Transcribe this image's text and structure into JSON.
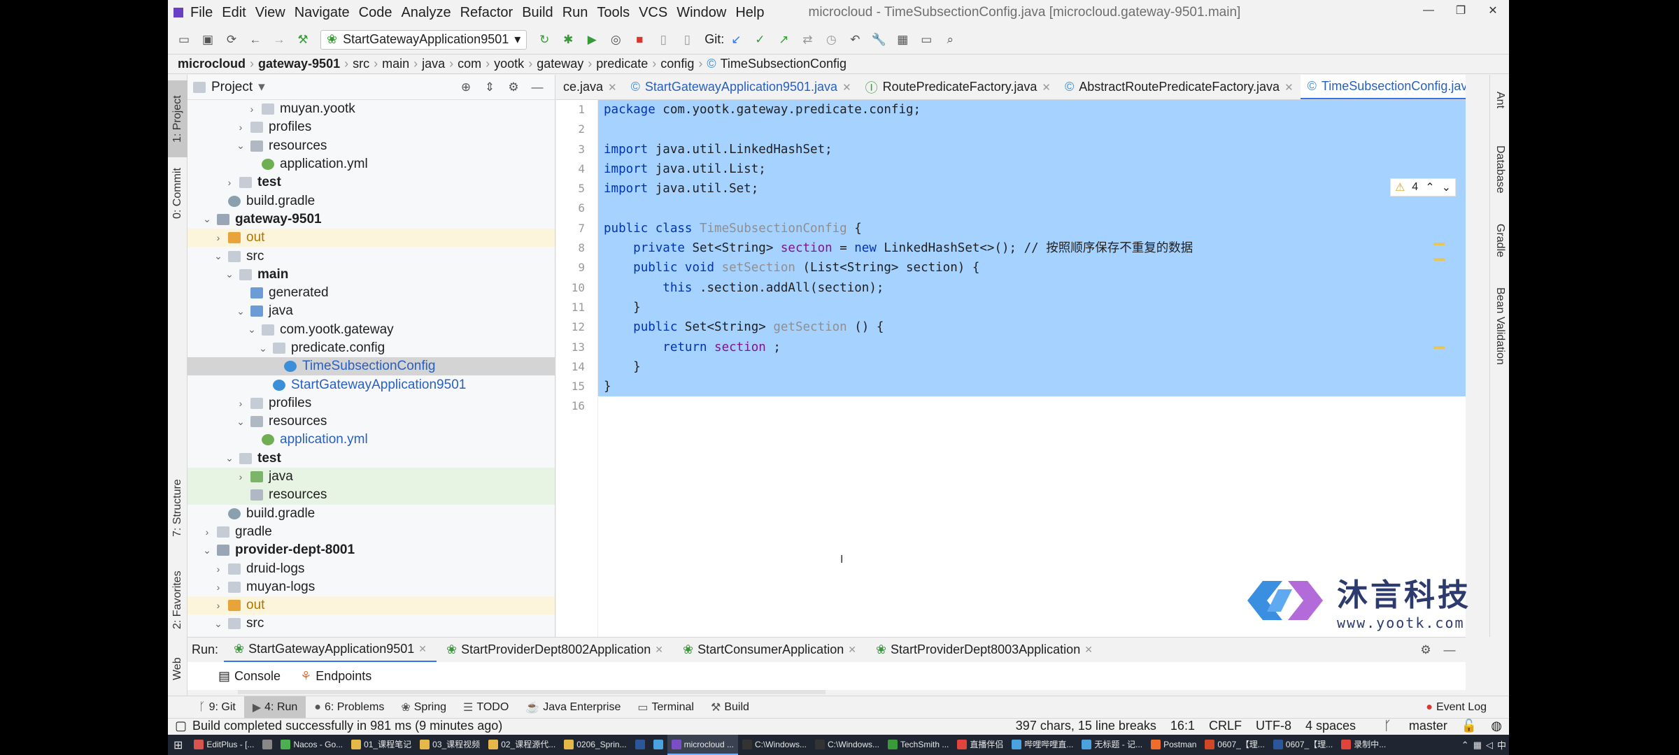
{
  "window": {
    "menu": [
      "File",
      "Edit",
      "View",
      "Navigate",
      "Code",
      "Analyze",
      "Refactor",
      "Build",
      "Run",
      "Tools",
      "VCS",
      "Window",
      "Help"
    ],
    "title": "microcloud - TimeSubsectionConfig.java [microcloud.gateway-9501.main]"
  },
  "toolbar": {
    "run_config": "StartGatewayApplication9501",
    "git_label": "Git:"
  },
  "breadcrumb": [
    "microcloud",
    "gateway-9501",
    "src",
    "main",
    "java",
    "com",
    "yootk",
    "gateway",
    "predicate",
    "config",
    "TimeSubsectionConfig"
  ],
  "left_strip": [
    "1: Project",
    "0: Commit",
    "7: Structure",
    "2: Favorites",
    "Web"
  ],
  "project": {
    "title": "Project",
    "tree": [
      {
        "label": "muyan.yootk",
        "level": 5,
        "chev": "›",
        "icon": "folder",
        "style": ""
      },
      {
        "label": "profiles",
        "level": 4,
        "chev": "›",
        "icon": "folder",
        "style": ""
      },
      {
        "label": "resources",
        "level": 4,
        "chev": "⌄",
        "icon": "folder res",
        "style": ""
      },
      {
        "label": "application.yml",
        "level": 5,
        "chev": "",
        "icon": "yml",
        "style": ""
      },
      {
        "label": "test",
        "level": 3,
        "chev": "›",
        "icon": "folder",
        "style": "bold"
      },
      {
        "label": "build.gradle",
        "level": 2,
        "chev": "",
        "icon": "gradle",
        "style": ""
      },
      {
        "label": "gateway-9501",
        "level": 1,
        "chev": "⌄",
        "icon": "module",
        "style": "bold"
      },
      {
        "label": "out",
        "level": 2,
        "chev": "›",
        "icon": "folder out",
        "style": "excl"
      },
      {
        "label": "src",
        "level": 2,
        "chev": "⌄",
        "icon": "folder",
        "style": ""
      },
      {
        "label": "main",
        "level": 3,
        "chev": "⌄",
        "icon": "folder",
        "style": "bold"
      },
      {
        "label": "generated",
        "level": 4,
        "chev": "",
        "icon": "folder src",
        "style": ""
      },
      {
        "label": "java",
        "level": 4,
        "chev": "⌄",
        "icon": "folder src",
        "style": ""
      },
      {
        "label": "com.yootk.gateway",
        "level": 5,
        "chev": "⌄",
        "icon": "folder",
        "style": ""
      },
      {
        "label": "predicate.config",
        "level": 6,
        "chev": "⌄",
        "icon": "folder",
        "style": ""
      },
      {
        "label": "TimeSubsectionConfig",
        "level": 7,
        "chev": "",
        "icon": "cls",
        "style": "sel blue"
      },
      {
        "label": "StartGatewayApplication9501",
        "level": 6,
        "chev": "",
        "icon": "cls",
        "style": "blue"
      },
      {
        "label": "profiles",
        "level": 4,
        "chev": "›",
        "icon": "folder",
        "style": ""
      },
      {
        "label": "resources",
        "level": 4,
        "chev": "⌄",
        "icon": "folder res",
        "style": ""
      },
      {
        "label": "application.yml",
        "level": 5,
        "chev": "",
        "icon": "yml",
        "style": "blue"
      },
      {
        "label": "test",
        "level": 3,
        "chev": "⌄",
        "icon": "folder",
        "style": "bold"
      },
      {
        "label": "java",
        "level": 4,
        "chev": "›",
        "icon": "folder tst",
        "style": "test"
      },
      {
        "label": "resources",
        "level": 4,
        "chev": "",
        "icon": "folder res",
        "style": "test"
      },
      {
        "label": "build.gradle",
        "level": 2,
        "chev": "",
        "icon": "gradle",
        "style": ""
      },
      {
        "label": "gradle",
        "level": 1,
        "chev": "›",
        "icon": "folder",
        "style": ""
      },
      {
        "label": "provider-dept-8001",
        "level": 1,
        "chev": "⌄",
        "icon": "module",
        "style": "bold"
      },
      {
        "label": "druid-logs",
        "level": 2,
        "chev": "›",
        "icon": "folder",
        "style": ""
      },
      {
        "label": "muyan-logs",
        "level": 2,
        "chev": "›",
        "icon": "folder",
        "style": ""
      },
      {
        "label": "out",
        "level": 2,
        "chev": "›",
        "icon": "folder out",
        "style": "excl"
      },
      {
        "label": "src",
        "level": 2,
        "chev": "⌄",
        "icon": "folder",
        "style": ""
      }
    ]
  },
  "editor_tabs": [
    {
      "label": "ce.java",
      "active": false
    },
    {
      "label": "StartGatewayApplication9501.java",
      "active": false
    },
    {
      "label": "RoutePredicateFactory.java",
      "active": false
    },
    {
      "label": "AbstractRoutePredicateFactory.java",
      "active": false
    },
    {
      "label": "TimeSubsectionConfig.java",
      "active": true
    }
  ],
  "inspection": {
    "warnings": "4"
  },
  "code_lines": [
    [
      [
        "kw",
        "package"
      ],
      [
        "",
        "com.yootk.gateway.predicate.config;"
      ]
    ],
    [],
    [
      [
        "kw",
        "import"
      ],
      [
        "",
        "java.util.LinkedHashSet;"
      ]
    ],
    [
      [
        "kw",
        "import"
      ],
      [
        "",
        "java.util.List;"
      ]
    ],
    [
      [
        "kw",
        "import"
      ],
      [
        "",
        "java.util.Set;"
      ]
    ],
    [],
    [
      [
        "kw",
        "public class"
      ],
      [
        "fn",
        "TimeSubsectionConfig"
      ],
      [
        "",
        "{"
      ]
    ],
    [
      [
        "",
        "    "
      ],
      [
        "kw",
        "private"
      ],
      [
        "",
        "Set<String>"
      ],
      [
        "fld",
        "section"
      ],
      [
        "",
        "="
      ],
      [
        "kw",
        "new"
      ],
      [
        "",
        "LinkedHashSet<>(); // 按照顺序保存不重复的数据"
      ]
    ],
    [
      [
        "",
        "    "
      ],
      [
        "kw",
        "public void"
      ],
      [
        "fn",
        "setSection"
      ],
      [
        "",
        "(List<String> section) {"
      ]
    ],
    [
      [
        "",
        "        "
      ],
      [
        "kw",
        "this"
      ],
      [
        "",
        ".section.addAll(section);"
      ]
    ],
    [
      [
        "",
        "    }"
      ]
    ],
    [
      [
        "",
        "    "
      ],
      [
        "kw",
        "public"
      ],
      [
        "",
        "Set<String>"
      ],
      [
        "fn",
        "getSection"
      ],
      [
        "",
        "() {"
      ]
    ],
    [
      [
        "",
        "        "
      ],
      [
        "kw",
        "return"
      ],
      [
        "fld",
        "section"
      ],
      [
        "",
        ";"
      ]
    ],
    [
      [
        "",
        "    }"
      ]
    ],
    [
      [
        "",
        "}"
      ]
    ],
    []
  ],
  "right_strip": [
    "Ant",
    "Database",
    "Gradle",
    "Bean Validation"
  ],
  "logo": {
    "cn": "沐言科技",
    "url": "www.yootk.com"
  },
  "run": {
    "label": "Run:",
    "tabs": [
      "StartGatewayApplication9501",
      "StartProviderDept8002Application",
      "StartConsumerApplication",
      "StartProviderDept8003Application"
    ],
    "subtabs": [
      "Console",
      "Endpoints"
    ]
  },
  "tool_windows": [
    "9: Git",
    "4: Run",
    "6: Problems",
    "Spring",
    "TODO",
    "Java Enterprise",
    "Terminal",
    "Build"
  ],
  "event_log": "Event Log",
  "status": {
    "message": "Build completed successfully in 981 ms (9 minutes ago)",
    "chars": "397 chars, 15 line breaks",
    "pos": "16:1",
    "eol": "CRLF",
    "enc": "UTF-8",
    "indent": "4 spaces",
    "branch": "master"
  },
  "taskbar": [
    {
      "label": "EditPlus - [...",
      "color": "#d9534f"
    },
    {
      "label": "",
      "color": "#888"
    },
    {
      "label": "Nacos - Go...",
      "color": "#4caf50"
    },
    {
      "label": "01_课程笔记",
      "color": "#e6b84a"
    },
    {
      "label": "03_课程视频",
      "color": "#e6b84a"
    },
    {
      "label": "02_课程源代...",
      "color": "#e6b84a"
    },
    {
      "label": "0206_Sprin...",
      "color": "#e6b84a"
    },
    {
      "label": "",
      "color": "#2b579a"
    },
    {
      "label": "",
      "color": "#4aa3df"
    },
    {
      "label": "microcloud ...",
      "color": "#7b4ec8"
    },
    {
      "label": "C:\\Windows...",
      "color": "#333"
    },
    {
      "label": "C:\\Windows...",
      "color": "#333"
    },
    {
      "label": "TechSmith ...",
      "color": "#3a9a3a"
    },
    {
      "label": "直播伴侣",
      "color": "#e0443a"
    },
    {
      "label": "哔哩哔哩直...",
      "color": "#4aa3df"
    },
    {
      "label": "无标题 - 记...",
      "color": "#4aa3df"
    },
    {
      "label": "Postman",
      "color": "#ef6c2a"
    },
    {
      "label": "0607_【理...",
      "color": "#d24726"
    },
    {
      "label": "0607_【理...",
      "color": "#2b579a"
    },
    {
      "label": "录制中...",
      "color": "#e0443a"
    }
  ]
}
